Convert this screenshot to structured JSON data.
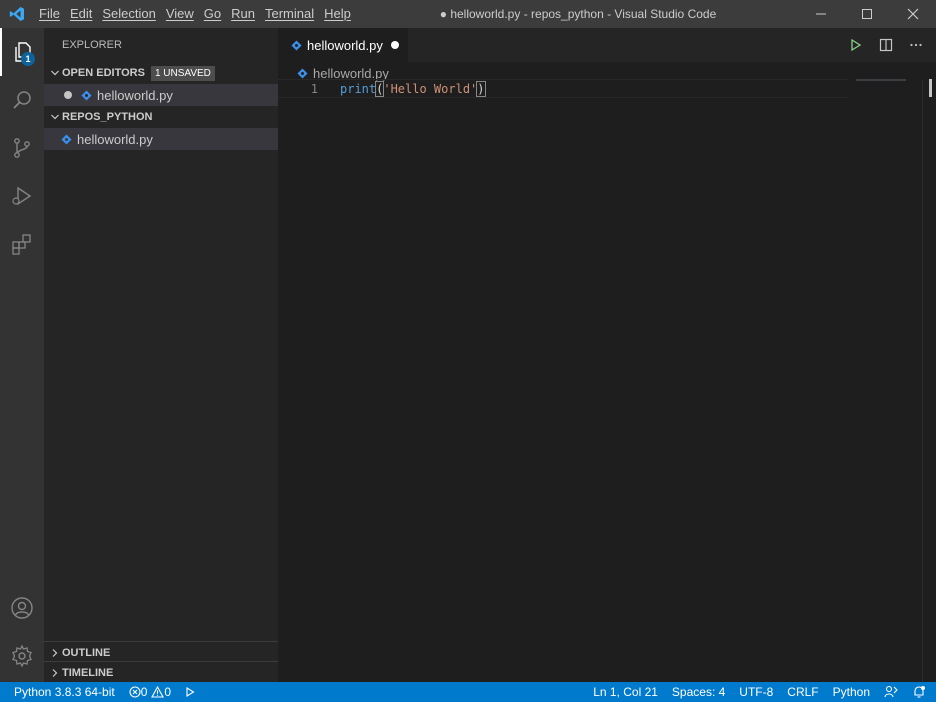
{
  "titlebar": {
    "menu": [
      "File",
      "Edit",
      "Selection",
      "View",
      "Go",
      "Run",
      "Terminal",
      "Help"
    ],
    "title": "● helloworld.py - repos_python - Visual Studio Code",
    "minimize": "—",
    "maximize": "☐",
    "close": "✕"
  },
  "activitybar": {
    "explorer_badge": "1",
    "items": [
      "files-icon",
      "search-icon",
      "source-control-icon",
      "run-debug-icon",
      "extensions-icon",
      "account-icon",
      "gear-icon"
    ]
  },
  "sidebar": {
    "title": "EXPLORER",
    "open_editors": {
      "label": "OPEN EDITORS",
      "badge": "1 UNSAVED",
      "files": [
        "helloworld.py"
      ]
    },
    "folder": {
      "label": "REPOS_PYTHON",
      "files": [
        "helloworld.py"
      ]
    },
    "outline": "OUTLINE",
    "timeline": "TIMELINE"
  },
  "editor": {
    "tab_label": "helloworld.py",
    "breadcrumb": "helloworld.py",
    "line_number": "1",
    "code": {
      "fn": "print",
      "open_paren": "(",
      "string": "'Hello World'",
      "close_paren": ")"
    }
  },
  "statusbar": {
    "interpreter": "Python 3.8.3 64-bit",
    "errors": "0",
    "warnings": "0",
    "position": "Ln 1, Col 21",
    "spaces": "Spaces: 4",
    "encoding": "UTF-8",
    "eol": "CRLF",
    "language": "Python"
  },
  "colors": {
    "accent": "#007acc",
    "python_icon": "#3b8eea",
    "string": "#ce9178",
    "keyword": "#569cd6"
  }
}
